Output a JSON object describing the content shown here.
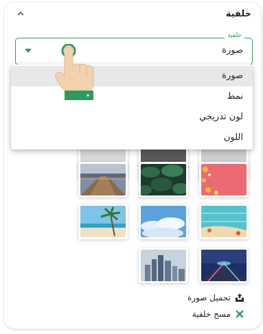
{
  "header": {
    "title": "خلفية",
    "icon": "chevron-up-icon"
  },
  "select": {
    "label": "خلفية",
    "value": "صورة",
    "accent": "#2e9b5c"
  },
  "dropdown": {
    "options": [
      "صورة",
      "نمط",
      "لون تدريجي",
      "اللون"
    ],
    "selected_index": 0
  },
  "thumbnails": [
    {
      "name": "hidden-thumb-1",
      "subject": "gray"
    },
    {
      "name": "hidden-thumb-2",
      "subject": "dark"
    },
    {
      "name": "hidden-thumb-3",
      "subject": "gray"
    },
    {
      "name": "wooden-pier",
      "subject": "pier"
    },
    {
      "name": "leaves",
      "subject": "leaves"
    },
    {
      "name": "pink-flowers",
      "subject": "flowers"
    },
    {
      "name": "beach-palm",
      "subject": "beach"
    },
    {
      "name": "sky-clouds",
      "subject": "sky"
    },
    {
      "name": "starfish-wood",
      "subject": "starfish"
    },
    {
      "name": "city-skyline",
      "subject": "city"
    },
    {
      "name": "light-road",
      "subject": "road"
    }
  ],
  "actions": {
    "upload_label": "تحميل صورة",
    "upload_icon": "upload-icon",
    "clear_label": "مسح خلفية",
    "clear_icon": "close-icon",
    "clear_color": "#2e9b5c"
  }
}
